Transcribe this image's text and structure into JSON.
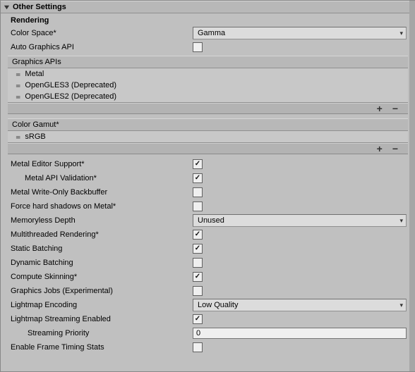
{
  "section_title": "Other Settings",
  "rendering_title": "Rendering",
  "color_space": {
    "label": "Color Space*",
    "value": "Gamma"
  },
  "auto_graphics": {
    "label": "Auto Graphics API",
    "checked": false
  },
  "graphics_apis": {
    "title": "Graphics APIs",
    "items": [
      "Metal",
      "OpenGLES3 (Deprecated)",
      "OpenGLES2 (Deprecated)"
    ]
  },
  "color_gamut": {
    "title": "Color Gamut*",
    "items": [
      "sRGB"
    ]
  },
  "plus": "+",
  "minus": "−",
  "fields": {
    "metal_editor": {
      "label": "Metal Editor Support*",
      "checked": true
    },
    "metal_api_valid": {
      "label": "Metal API Validation*",
      "checked": true
    },
    "metal_writeonly": {
      "label": "Metal Write-Only Backbuffer",
      "checked": false
    },
    "force_hard_shadows": {
      "label": "Force hard shadows on Metal*",
      "checked": false
    },
    "memoryless": {
      "label": "Memoryless Depth",
      "value": "Unused"
    },
    "multithreaded": {
      "label": "Multithreaded Rendering*",
      "checked": true
    },
    "static_batch": {
      "label": "Static Batching",
      "checked": true
    },
    "dynamic_batch": {
      "label": "Dynamic Batching",
      "checked": false
    },
    "compute_skin": {
      "label": "Compute Skinning*",
      "checked": true
    },
    "graphics_jobs": {
      "label": "Graphics Jobs (Experimental)",
      "checked": false
    },
    "lightmap_enc": {
      "label": "Lightmap Encoding",
      "value": "Low Quality"
    },
    "lightmap_stream": {
      "label": "Lightmap Streaming Enabled",
      "checked": true
    },
    "stream_priority": {
      "label": "Streaming Priority",
      "value": "0"
    },
    "frame_timing": {
      "label": "Enable Frame Timing Stats",
      "checked": false
    }
  }
}
